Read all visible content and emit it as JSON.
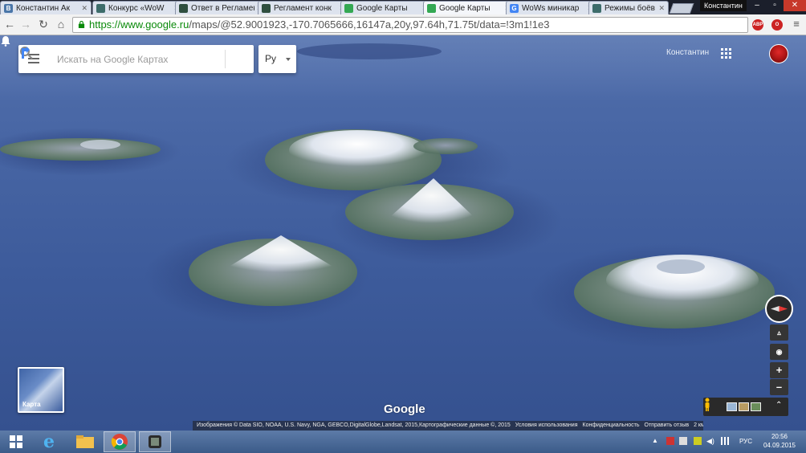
{
  "browser": {
    "tabs": [
      {
        "title": "Константин Ак",
        "favicon_text": "B",
        "favicon_color": "#4a76a8",
        "active": false
      },
      {
        "title": "Конкурс «WoW",
        "favicon_text": "",
        "favicon_color": "#3d6c6a",
        "active": false
      },
      {
        "title": "Ответ в Регламен",
        "favicon_text": "",
        "favicon_color": "#2f4f3f",
        "active": false
      },
      {
        "title": "Регламент конк",
        "favicon_text": "",
        "favicon_color": "#2f4f3f",
        "active": false
      },
      {
        "title": "Google Карты",
        "favicon_text": "",
        "favicon_color": "#34a853",
        "active": false
      },
      {
        "title": "Google Карты",
        "favicon_text": "",
        "favicon_color": "#34a853",
        "active": true
      },
      {
        "title": "WoWs миникар",
        "favicon_text": "G",
        "favicon_color": "#4285f4",
        "active": false
      },
      {
        "title": "Режимы боёв (",
        "favicon_text": "",
        "favicon_color": "#3d6c6a",
        "active": false
      }
    ],
    "user_badge": "Константин",
    "window_buttons": [
      "–",
      "▫",
      "✕"
    ],
    "url_scheme": "https://",
    "url_host": "www.google.ru",
    "url_path": "/maps/@52.9001923,-170.7065666,16147a,20y,97.64h,71.75t/data=!3m1!1e3",
    "extensions": [
      {
        "label": "ABP",
        "color": "#c22"
      },
      {
        "label": "O",
        "color": "#c22"
      }
    ]
  },
  "maps": {
    "menu_icon": "menu-icon",
    "search_placeholder": "Искать на Google Картах",
    "search_value": "",
    "language": "Ру",
    "user_name": "Константин",
    "minimap_label": "Карта",
    "logo": "Google",
    "attribution": [
      "Изображения © Data SIO, NOAA, U.S. Navy, NGA, GEBCO,DigitalGlobe,Landsat, 2015,Картографические данные ©, 2015",
      "Условия использования",
      "Конфиденциальность",
      "Отправить отзыв",
      "2 км"
    ],
    "zoom_in": "+",
    "zoom_out": "–"
  },
  "taskbar": {
    "language": "РУС",
    "time": "20:56",
    "date": "04.09.2015"
  },
  "colors": {
    "sea": "#3f5f9f",
    "accent_blue": "#4285f4"
  }
}
